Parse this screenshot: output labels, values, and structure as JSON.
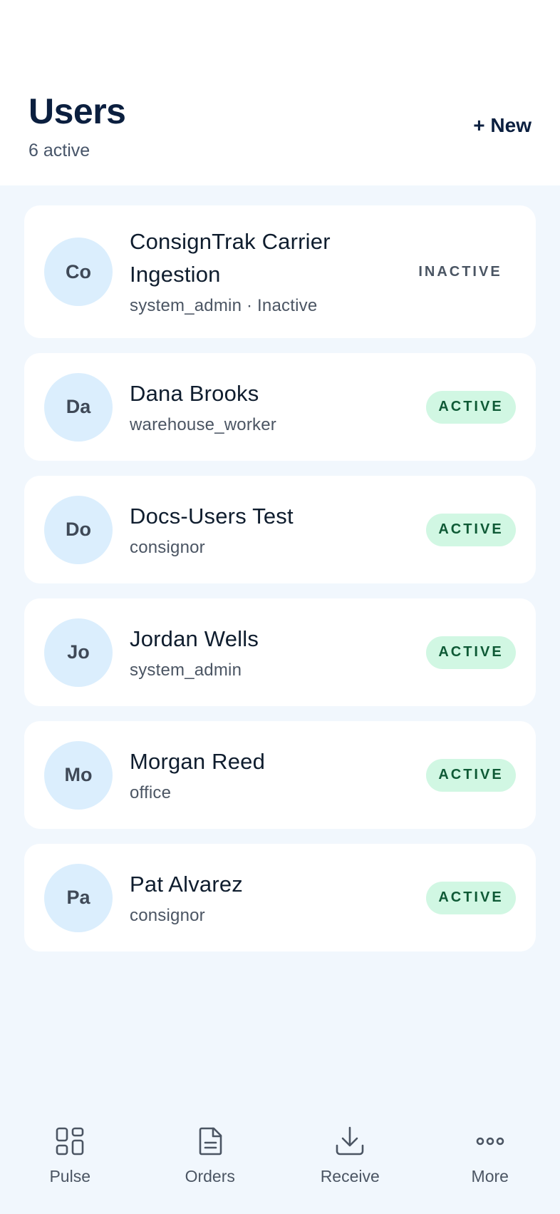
{
  "header": {
    "title": "Users",
    "subtitle": "6 active",
    "new_button_label": "+ New"
  },
  "users": [
    {
      "initials": "Co",
      "name": "ConsignTrak Carrier Ingestion",
      "role": "system_admin · Inactive",
      "status": "INACTIVE"
    },
    {
      "initials": "Da",
      "name": "Dana Brooks",
      "role": "warehouse_worker",
      "status": "ACTIVE"
    },
    {
      "initials": "Do",
      "name": "Docs-Users Test",
      "role": "consignor",
      "status": "ACTIVE"
    },
    {
      "initials": "Jo",
      "name": "Jordan Wells",
      "role": "system_admin",
      "status": "ACTIVE"
    },
    {
      "initials": "Mo",
      "name": "Morgan Reed",
      "role": "office",
      "status": "ACTIVE"
    },
    {
      "initials": "Pa",
      "name": "Pat Alvarez",
      "role": "consignor",
      "status": "ACTIVE"
    }
  ],
  "nav": {
    "items": [
      {
        "label": "Pulse",
        "icon": "grid-icon"
      },
      {
        "label": "Orders",
        "icon": "document-icon"
      },
      {
        "label": "Receive",
        "icon": "download-icon"
      },
      {
        "label": "More",
        "icon": "more-dots-icon"
      }
    ]
  },
  "colors": {
    "page_background": "#f1f7fd",
    "header_background": "#ffffff",
    "title": "#0b1f3f",
    "avatar_background": "#dbeefd",
    "active_badge_background": "#d1f7e3",
    "active_badge_text": "#0f5a36",
    "inactive_text": "#4a5563"
  }
}
